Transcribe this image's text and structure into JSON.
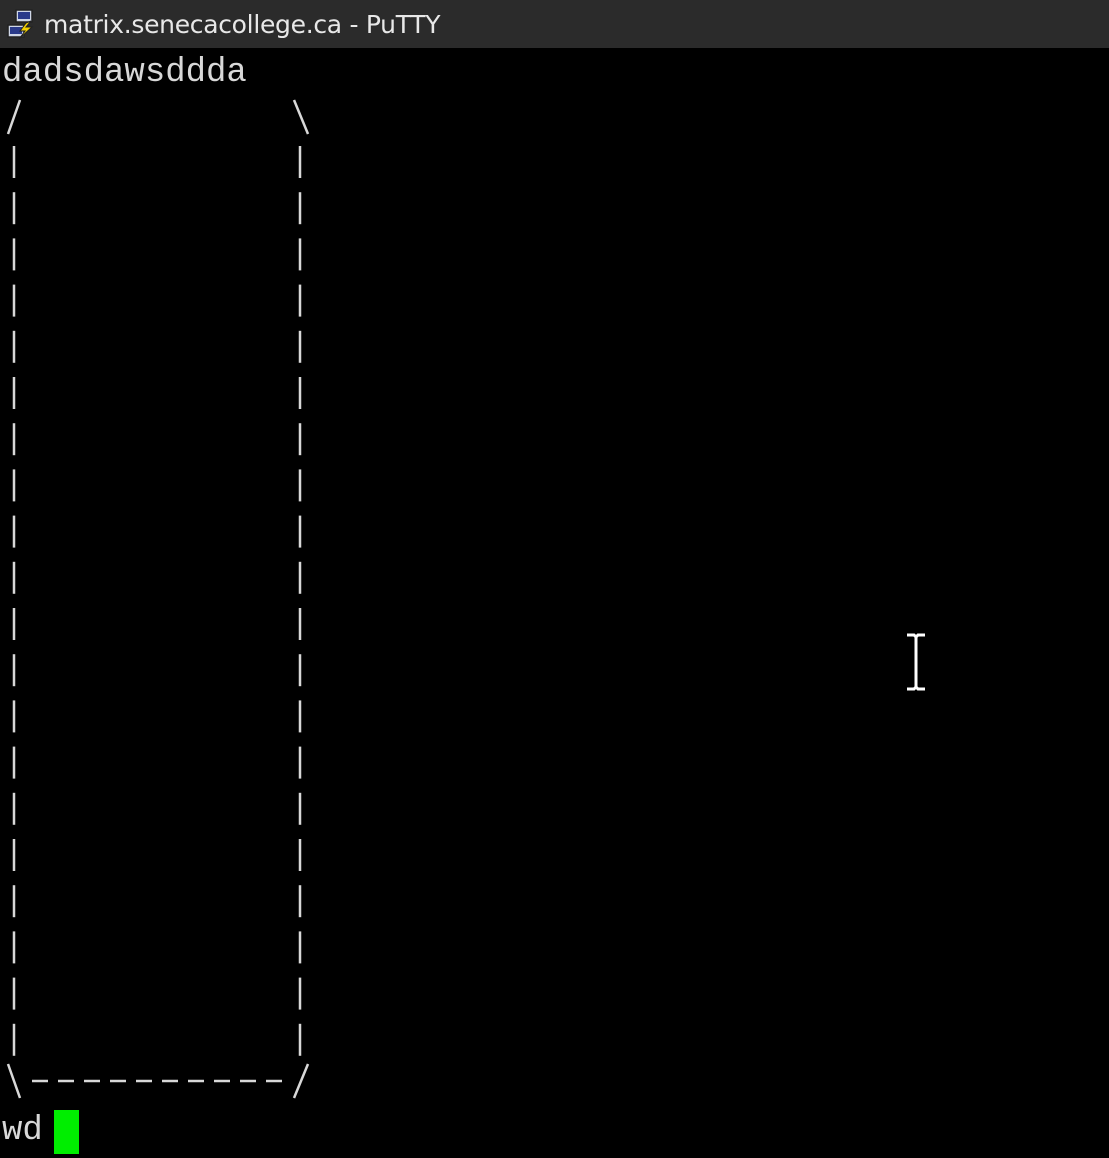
{
  "window": {
    "title": "matrix.senecacollege.ca - PuTTY",
    "icon": "putty-icon"
  },
  "terminal": {
    "lines": [
      "dadsdawsddda"
    ],
    "prompt_text": "wd",
    "cursor_color": "#00ee00",
    "foreground": "#d8d8d8",
    "background": "#000000"
  },
  "ascii_box": {
    "top_left": "/",
    "top_right": "\\",
    "side": "|",
    "bottom": "\\----------/"
  }
}
